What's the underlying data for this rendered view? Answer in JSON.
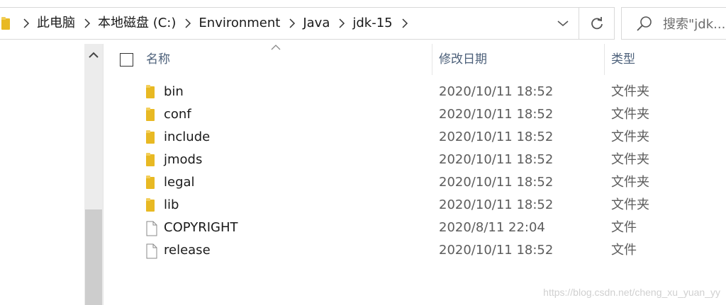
{
  "address_bar": {
    "breadcrumbs": [
      "此电脑",
      "本地磁盘 (C:)",
      "Environment",
      "Java",
      "jdk-15"
    ]
  },
  "search": {
    "placeholder": "搜索\"jdk..."
  },
  "columns": {
    "name": "名称",
    "date_modified": "修改日期",
    "type": "类型"
  },
  "files": [
    {
      "name": "bin",
      "date": "2020/10/11 18:52",
      "type": "文件夹",
      "icon": "folder-icon"
    },
    {
      "name": "conf",
      "date": "2020/10/11 18:52",
      "type": "文件夹",
      "icon": "folder-icon"
    },
    {
      "name": "include",
      "date": "2020/10/11 18:52",
      "type": "文件夹",
      "icon": "folder-icon"
    },
    {
      "name": "jmods",
      "date": "2020/10/11 18:52",
      "type": "文件夹",
      "icon": "folder-icon"
    },
    {
      "name": "legal",
      "date": "2020/10/11 18:52",
      "type": "文件夹",
      "icon": "folder-icon"
    },
    {
      "name": "lib",
      "date": "2020/10/11 18:52",
      "type": "文件夹",
      "icon": "folder-icon"
    },
    {
      "name": "COPYRIGHT",
      "date": "2020/8/11 22:04",
      "type": "文件",
      "icon": "file-icon"
    },
    {
      "name": "release",
      "date": "2020/10/11 18:52",
      "type": "文件",
      "icon": "file-icon"
    }
  ],
  "watermark": "https://blog.csdn.net/cheng_xu_yuan_yy",
  "colors": {
    "folder": "#e8b923",
    "header_text": "#4c607a",
    "scrollbar_thumb": "#cdcdcd"
  }
}
